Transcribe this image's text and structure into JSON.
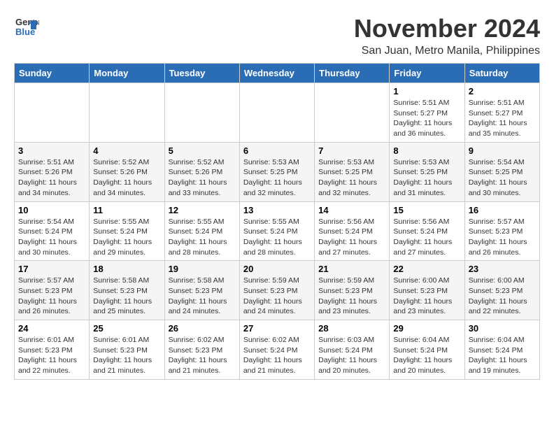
{
  "logo": {
    "general": "General",
    "blue": "Blue"
  },
  "title": "November 2024",
  "location": "San Juan, Metro Manila, Philippines",
  "headers": [
    "Sunday",
    "Monday",
    "Tuesday",
    "Wednesday",
    "Thursday",
    "Friday",
    "Saturday"
  ],
  "weeks": [
    [
      {
        "day": "",
        "detail": ""
      },
      {
        "day": "",
        "detail": ""
      },
      {
        "day": "",
        "detail": ""
      },
      {
        "day": "",
        "detail": ""
      },
      {
        "day": "",
        "detail": ""
      },
      {
        "day": "1",
        "detail": "Sunrise: 5:51 AM\nSunset: 5:27 PM\nDaylight: 11 hours\nand 36 minutes."
      },
      {
        "day": "2",
        "detail": "Sunrise: 5:51 AM\nSunset: 5:27 PM\nDaylight: 11 hours\nand 35 minutes."
      }
    ],
    [
      {
        "day": "3",
        "detail": "Sunrise: 5:51 AM\nSunset: 5:26 PM\nDaylight: 11 hours\nand 34 minutes."
      },
      {
        "day": "4",
        "detail": "Sunrise: 5:52 AM\nSunset: 5:26 PM\nDaylight: 11 hours\nand 34 minutes."
      },
      {
        "day": "5",
        "detail": "Sunrise: 5:52 AM\nSunset: 5:26 PM\nDaylight: 11 hours\nand 33 minutes."
      },
      {
        "day": "6",
        "detail": "Sunrise: 5:53 AM\nSunset: 5:25 PM\nDaylight: 11 hours\nand 32 minutes."
      },
      {
        "day": "7",
        "detail": "Sunrise: 5:53 AM\nSunset: 5:25 PM\nDaylight: 11 hours\nand 32 minutes."
      },
      {
        "day": "8",
        "detail": "Sunrise: 5:53 AM\nSunset: 5:25 PM\nDaylight: 11 hours\nand 31 minutes."
      },
      {
        "day": "9",
        "detail": "Sunrise: 5:54 AM\nSunset: 5:25 PM\nDaylight: 11 hours\nand 30 minutes."
      }
    ],
    [
      {
        "day": "10",
        "detail": "Sunrise: 5:54 AM\nSunset: 5:24 PM\nDaylight: 11 hours\nand 30 minutes."
      },
      {
        "day": "11",
        "detail": "Sunrise: 5:55 AM\nSunset: 5:24 PM\nDaylight: 11 hours\nand 29 minutes."
      },
      {
        "day": "12",
        "detail": "Sunrise: 5:55 AM\nSunset: 5:24 PM\nDaylight: 11 hours\nand 28 minutes."
      },
      {
        "day": "13",
        "detail": "Sunrise: 5:55 AM\nSunset: 5:24 PM\nDaylight: 11 hours\nand 28 minutes."
      },
      {
        "day": "14",
        "detail": "Sunrise: 5:56 AM\nSunset: 5:24 PM\nDaylight: 11 hours\nand 27 minutes."
      },
      {
        "day": "15",
        "detail": "Sunrise: 5:56 AM\nSunset: 5:24 PM\nDaylight: 11 hours\nand 27 minutes."
      },
      {
        "day": "16",
        "detail": "Sunrise: 5:57 AM\nSunset: 5:23 PM\nDaylight: 11 hours\nand 26 minutes."
      }
    ],
    [
      {
        "day": "17",
        "detail": "Sunrise: 5:57 AM\nSunset: 5:23 PM\nDaylight: 11 hours\nand 26 minutes."
      },
      {
        "day": "18",
        "detail": "Sunrise: 5:58 AM\nSunset: 5:23 PM\nDaylight: 11 hours\nand 25 minutes."
      },
      {
        "day": "19",
        "detail": "Sunrise: 5:58 AM\nSunset: 5:23 PM\nDaylight: 11 hours\nand 24 minutes."
      },
      {
        "day": "20",
        "detail": "Sunrise: 5:59 AM\nSunset: 5:23 PM\nDaylight: 11 hours\nand 24 minutes."
      },
      {
        "day": "21",
        "detail": "Sunrise: 5:59 AM\nSunset: 5:23 PM\nDaylight: 11 hours\nand 23 minutes."
      },
      {
        "day": "22",
        "detail": "Sunrise: 6:00 AM\nSunset: 5:23 PM\nDaylight: 11 hours\nand 23 minutes."
      },
      {
        "day": "23",
        "detail": "Sunrise: 6:00 AM\nSunset: 5:23 PM\nDaylight: 11 hours\nand 22 minutes."
      }
    ],
    [
      {
        "day": "24",
        "detail": "Sunrise: 6:01 AM\nSunset: 5:23 PM\nDaylight: 11 hours\nand 22 minutes."
      },
      {
        "day": "25",
        "detail": "Sunrise: 6:01 AM\nSunset: 5:23 PM\nDaylight: 11 hours\nand 21 minutes."
      },
      {
        "day": "26",
        "detail": "Sunrise: 6:02 AM\nSunset: 5:23 PM\nDaylight: 11 hours\nand 21 minutes."
      },
      {
        "day": "27",
        "detail": "Sunrise: 6:02 AM\nSunset: 5:24 PM\nDaylight: 11 hours\nand 21 minutes."
      },
      {
        "day": "28",
        "detail": "Sunrise: 6:03 AM\nSunset: 5:24 PM\nDaylight: 11 hours\nand 20 minutes."
      },
      {
        "day": "29",
        "detail": "Sunrise: 6:04 AM\nSunset: 5:24 PM\nDaylight: 11 hours\nand 20 minutes."
      },
      {
        "day": "30",
        "detail": "Sunrise: 6:04 AM\nSunset: 5:24 PM\nDaylight: 11 hours\nand 19 minutes."
      }
    ]
  ]
}
